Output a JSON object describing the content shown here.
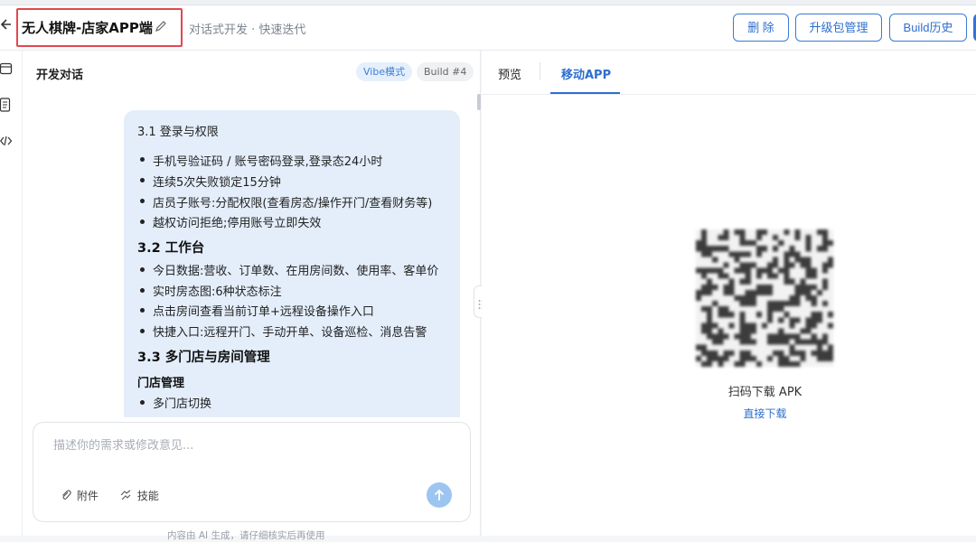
{
  "header": {
    "title": "无人棋牌-店家APP端",
    "subtitle": "对话式开发 · 快速迭代",
    "buttons": {
      "delete": "删 除",
      "upgrade": "升级包管理",
      "build_history": "Build历史"
    }
  },
  "sidebar": {
    "icons": [
      "window-icon",
      "document-icon",
      "code-icon"
    ]
  },
  "chat": {
    "title": "开发对话",
    "mode_badge": "Vibe模式",
    "build_badge": "Build #4",
    "message": {
      "section_31": "3.1 登录与权限",
      "items_31": [
        "手机号验证码 / 账号密码登录,登录态24小时",
        "连续5次失败锁定15分钟",
        "店员子账号:分配权限(查看房态/操作开门/查看财务等)",
        "越权访问拒绝;停用账号立即失效"
      ],
      "section_32": "3.2 工作台",
      "items_32": [
        "今日数据:营收、订单数、在用房间数、使用率、客单价",
        "实时房态图:6种状态标注",
        "点击房间查看当前订单+远程设备操作入口",
        "快捷入口:远程开门、手动开单、设备巡检、消息告警"
      ],
      "section_33": "3.3 多门店与房间管理",
      "subsection": "门店管理",
      "items_33": [
        "多门店切换"
      ]
    },
    "input": {
      "placeholder": "描述你的需求或修改意见...",
      "value": ""
    },
    "attach_label": "附件",
    "skill_label": "技能",
    "footer_note": "内容由 AI 生成，请仔细核实后再使用"
  },
  "preview": {
    "tabs": [
      "预览",
      "移动APP"
    ],
    "active_tab": "移动APP",
    "scan_label": "扫码下载 APK",
    "direct_download": "直接下载"
  },
  "colors": {
    "accent": "#2d6fcf",
    "highlight_border": "#e2474e",
    "bubble_bg": "#e4eefb"
  }
}
